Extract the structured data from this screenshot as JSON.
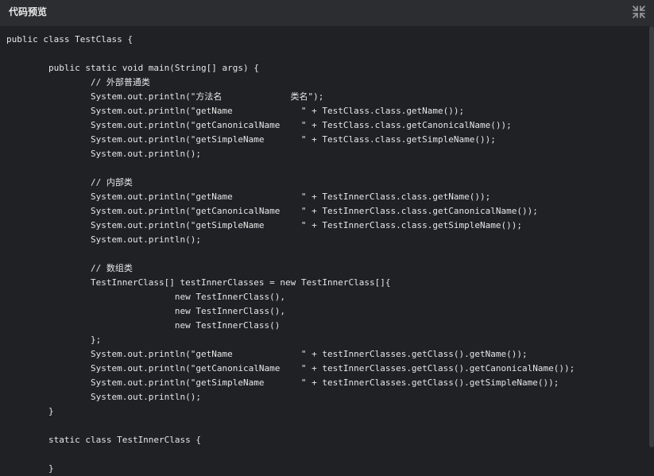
{
  "header": {
    "title": "代码预览",
    "collapse_icon": "collapse-arrows-icon"
  },
  "code": {
    "language": "java",
    "lines": [
      "public class TestClass {",
      "",
      "        public static void main(String[] args) {",
      "                // 外部普通类",
      "                System.out.println(\"方法名             类名\");",
      "                System.out.println(\"getName             \" + TestClass.class.getName());",
      "                System.out.println(\"getCanonicalName    \" + TestClass.class.getCanonicalName());",
      "                System.out.println(\"getSimpleName       \" + TestClass.class.getSimpleName());",
      "                System.out.println();",
      "",
      "                // 内部类",
      "                System.out.println(\"getName             \" + TestInnerClass.class.getName());",
      "                System.out.println(\"getCanonicalName    \" + TestInnerClass.class.getCanonicalName());",
      "                System.out.println(\"getSimpleName       \" + TestInnerClass.class.getSimpleName());",
      "                System.out.println();",
      "",
      "                // 数组类",
      "                TestInnerClass[] testInnerClasses = new TestInnerClass[]{",
      "                                new TestInnerClass(),",
      "                                new TestInnerClass(),",
      "                                new TestInnerClass()",
      "                };",
      "                System.out.println(\"getName             \" + testInnerClasses.getClass().getName());",
      "                System.out.println(\"getCanonicalName    \" + testInnerClasses.getClass().getCanonicalName());",
      "                System.out.println(\"getSimpleName       \" + testInnerClasses.getClass().getSimpleName());",
      "                System.out.println();",
      "        }",
      "",
      "        static class TestInnerClass {",
      "",
      "        }"
    ]
  },
  "colors": {
    "background": "#1f2124",
    "titlebar": "#2b2d30",
    "text": "#e6e6e6"
  }
}
